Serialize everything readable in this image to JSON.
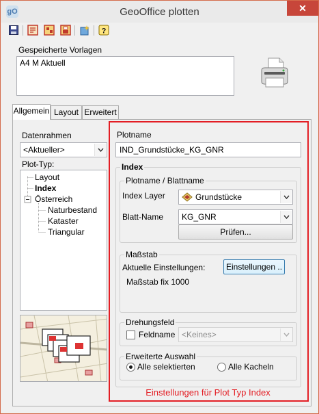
{
  "window": {
    "title": "GeoOffice plotten",
    "close_label": "✕",
    "app_icon_text": "gO"
  },
  "toolbar": {
    "icons": [
      "save-icon",
      "plot-frame-icon",
      "plot-layout-icon",
      "plot-settings-icon",
      "wizard-icon",
      "help-icon"
    ]
  },
  "templates": {
    "label": "Gespeicherte Vorlagen",
    "items": [
      "A4 M Aktuell"
    ]
  },
  "tabs": [
    {
      "label": "Allgemein",
      "active": true
    },
    {
      "label": "Layout",
      "active": false
    },
    {
      "label": "Erweitert",
      "active": false
    }
  ],
  "left": {
    "datenrahmen_label": "Datenrahmen",
    "datenrahmen_value": "<Aktueller>",
    "plottyp_label": "Plot-Typ:",
    "tree": [
      "Layout",
      "Index",
      "Österreich",
      "Naturbestand",
      "Kataster",
      "Triangular"
    ]
  },
  "right": {
    "plotname_label": "Plotname",
    "plotname_value": "IND_Grundstücke_KG_GNR",
    "index_legend": "Index",
    "plotname_blatt_legend": "Plotname / Blattname",
    "index_layer_label": "Index Layer",
    "index_layer_value": "Grundstücke",
    "blatt_name_label": "Blatt-Name",
    "blatt_name_value": "KG_GNR",
    "pruefen_label": "Prüfen...",
    "massstab_legend": "Maßstab",
    "aktuelle_label": "Aktuelle Einstellungen:",
    "einstellungen_label": "Einstellungen ..",
    "massstab_value": "Maßstab fix 1000",
    "drehungsfeld_legend": "Drehungsfeld",
    "feldname_label": "Feldname",
    "feldname_value": "<Keines>",
    "erweiterte_legend": "Erweiterte Auswahl",
    "radio_all_selected": "Alle selektierten",
    "radio_all_tiles": "Alle Kacheln"
  },
  "caption": "Einstellungen für Plot Typ Index",
  "colors": {
    "highlight": "#e31e24",
    "close": "#c7463a"
  }
}
